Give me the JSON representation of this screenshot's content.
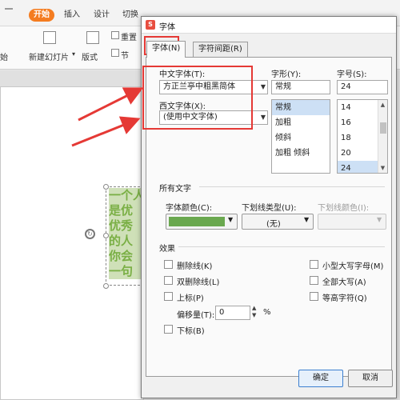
{
  "ribbon": {
    "tabs": [
      "开始",
      "插入",
      "设计",
      "切换"
    ],
    "new_slide_label": "新建幻灯片",
    "layout_label": "版式",
    "section_label": "节",
    "reset_label": "重置",
    "left_label": "始"
  },
  "slide": {
    "lines": [
      "一个人",
      "是优",
      "优秀",
      "的人",
      "你会",
      "一句"
    ]
  },
  "dialog": {
    "title": "字体",
    "tabs": [
      "字体(N)",
      "字符间距(R)"
    ],
    "chinese_font": {
      "label": "中文字体(T):",
      "value": "方正兰亭中粗黑简体"
    },
    "western_font": {
      "label": "西文字体(X):",
      "value": "(使用中文字体)"
    },
    "style": {
      "label": "字形(Y):",
      "value": "常规",
      "options": [
        "常规",
        "加粗",
        "倾斜",
        "加粗 倾斜"
      ],
      "selected": "常规"
    },
    "size": {
      "label": "字号(S):",
      "value": "24",
      "options": [
        "14",
        "16",
        "18",
        "20",
        "24"
      ],
      "selected": "24"
    },
    "all_text": {
      "header": "所有文字",
      "font_color_label": "字体颜色(C):",
      "font_color": "#6aa84f",
      "underline_type_label": "下划线类型(U):",
      "underline_type_value": "(无)",
      "underline_color_label": "下划线颜色(I):"
    },
    "effects": {
      "header": "效果",
      "left": [
        "删除线(K)",
        "双删除线(L)",
        "上标(P)"
      ],
      "offset_label": "偏移量(T):",
      "offset_value": "0",
      "offset_unit": "%",
      "subscript": "下标(B)",
      "right": [
        "小型大写字母(M)",
        "全部大写(A)",
        "等高字符(Q)"
      ]
    },
    "buttons": {
      "ok": "确定",
      "cancel": "取消"
    }
  },
  "colors": {
    "accent_tab": "#f47c20",
    "annotation_red": "#e53935",
    "slide_text": "#7aaf45"
  }
}
